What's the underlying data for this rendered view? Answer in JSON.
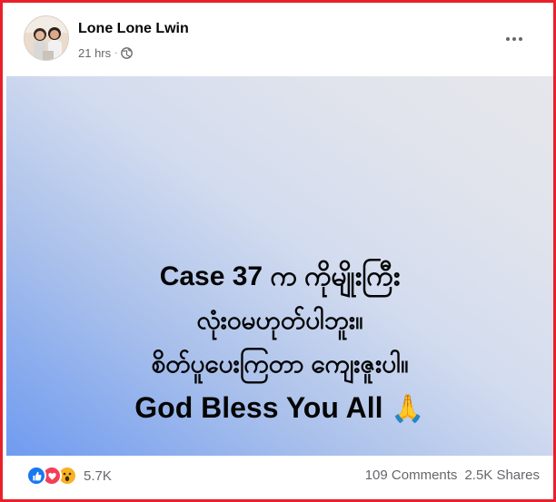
{
  "post": {
    "author": "Lone Lone Lwin",
    "time": "21 hrs",
    "separator": "·",
    "privacy_icon": "globe-icon",
    "menu_icon": "more-options-icon"
  },
  "image": {
    "line1": "Case 37 က ကိုမျိုးကြီး",
    "line2": "လုံးဝမဟုတ်ပါဘူး။",
    "line3": "စိတ်ပူပေးကြတာ ကျေးဇူးပါ။",
    "line4": "God Bless You All",
    "line4_emoji": "🙏"
  },
  "reactions": {
    "icons": [
      "like-icon",
      "love-icon",
      "wow-icon"
    ],
    "count": "5.7K"
  },
  "stats": {
    "comments": "109 Comments",
    "shares": "2.5K Shares"
  },
  "colors": {
    "frame_border": "#e8202a",
    "like": "#1877f2",
    "love": "#f33e58",
    "wow": "#f7b125",
    "secondary_text": "#65676b"
  }
}
